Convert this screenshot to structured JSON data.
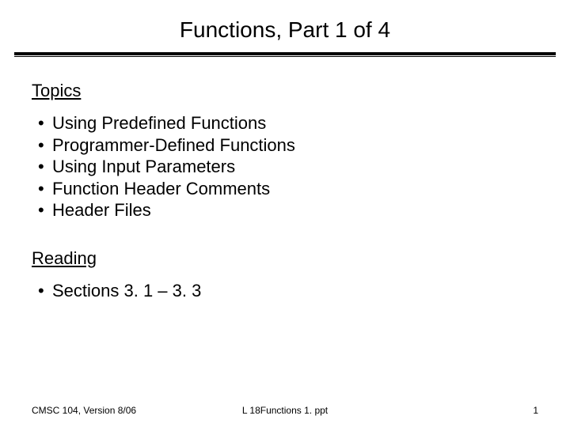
{
  "title": "Functions, Part 1 of 4",
  "sections": {
    "topics": {
      "heading": "Topics",
      "items": [
        "Using Predefined Functions",
        "Programmer-Defined Functions",
        "Using Input Parameters",
        "Function Header Comments",
        "Header Files"
      ]
    },
    "reading": {
      "heading": "Reading",
      "items": [
        "Sections 3. 1 – 3. 3"
      ]
    }
  },
  "footer": {
    "left": "CMSC 104, Version 8/06",
    "center": "L 18Functions 1. ppt",
    "right": "1"
  }
}
